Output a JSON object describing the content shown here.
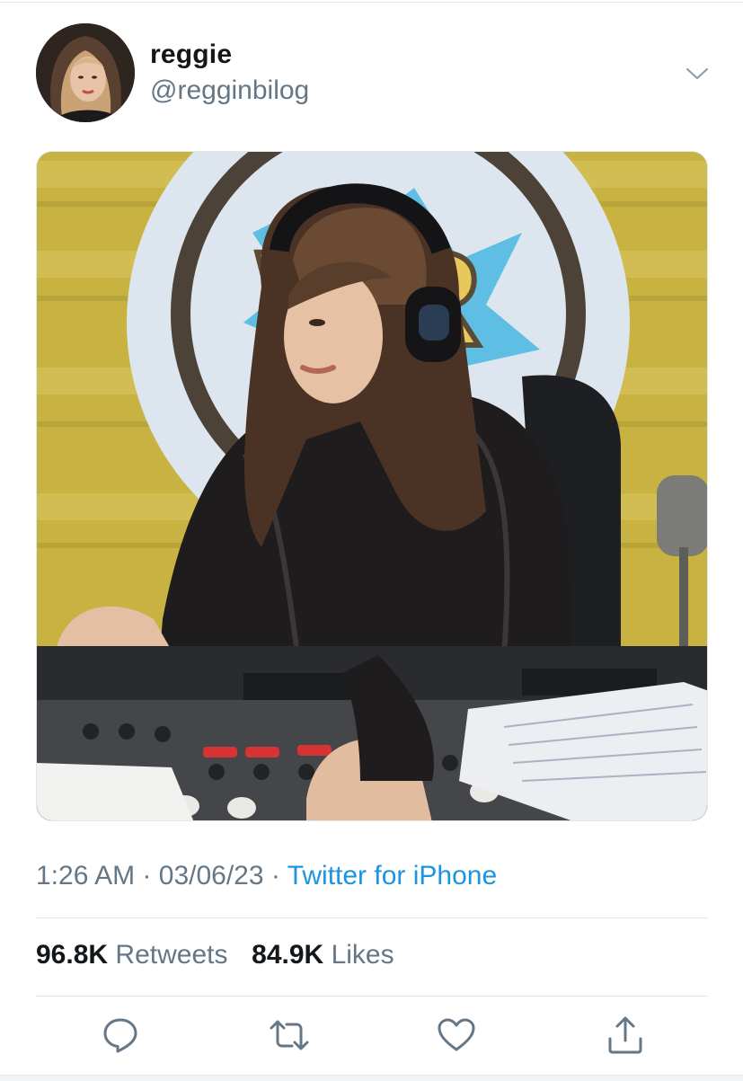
{
  "tweet": {
    "author": {
      "display_name": "reggie",
      "handle": "@regginbilog"
    },
    "media": {
      "description_icon": "photo"
    },
    "time": "1:26 AM",
    "separator": "·",
    "date": "03/06/23",
    "source": "Twitter for iPhone",
    "stats": {
      "retweets_count": "96.8K",
      "retweets_label": "Retweets",
      "likes_count": "84.9K",
      "likes_label": "Likes"
    },
    "actions": [
      {
        "name": "reply",
        "icon": "reply-icon"
      },
      {
        "name": "retweet",
        "icon": "retweet-icon"
      },
      {
        "name": "like",
        "icon": "heart-icon"
      },
      {
        "name": "share",
        "icon": "share-icon"
      }
    ]
  },
  "colors": {
    "link": "#1b95e0",
    "secondary_text": "#657786",
    "primary_text": "#14171a",
    "divider": "#e1e8ed"
  }
}
